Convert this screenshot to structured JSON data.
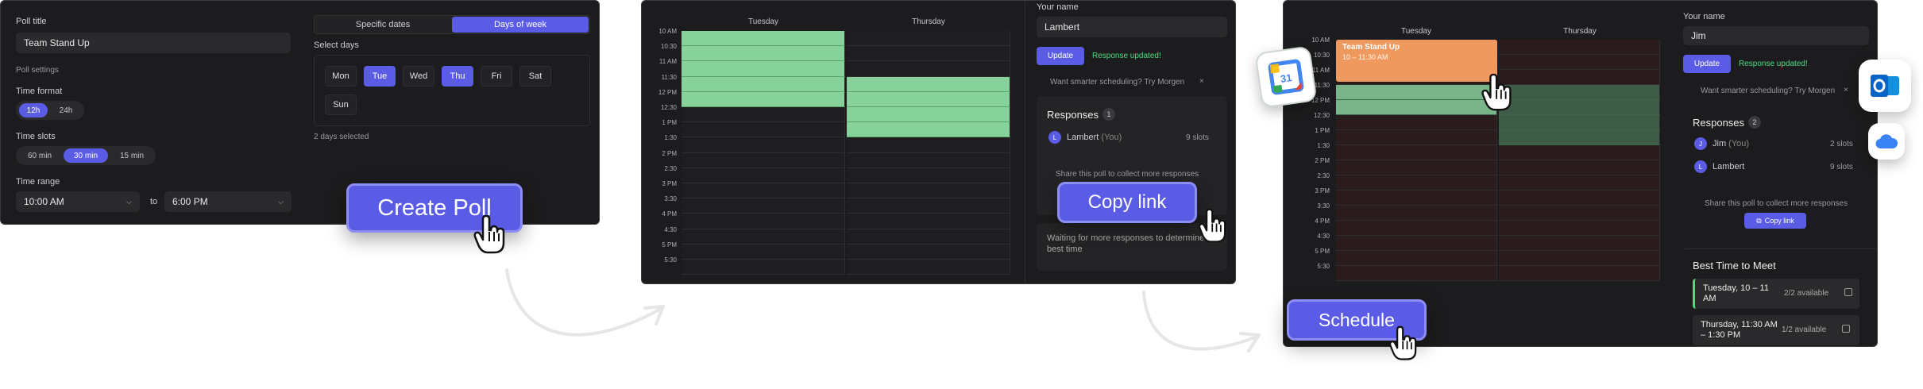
{
  "colors": {
    "accent": "#5b5ce6",
    "slot_green": "#86d29a",
    "event_orange": "#f0995f",
    "success_green": "#4ade80"
  },
  "panel1": {
    "poll_title_label": "Poll title",
    "poll_title_value": "Team Stand Up",
    "poll_settings_label": "Poll settings",
    "time_format_label": "Time format",
    "time_format_options": [
      "12h",
      "24h"
    ],
    "time_slots_label": "Time slots",
    "time_slot_options": [
      "60 min",
      "30 min",
      "15 min"
    ],
    "time_range_label": "Time range",
    "range_start": "10:00 AM",
    "range_to": "to",
    "range_end": "6:00 PM",
    "tab_specific": "Specific dates",
    "tab_days": "Days of week",
    "select_days_label": "Select days",
    "days": [
      "Mon",
      "Tue",
      "Wed",
      "Thu",
      "Fri",
      "Sat",
      "Sun"
    ],
    "days_selected": "2 days selected",
    "create_poll": "Create Poll"
  },
  "panel2": {
    "col_tuesday": "Tuesday",
    "col_thursday": "Thursday",
    "times": [
      "10 AM",
      "10:30",
      "11 AM",
      "11:30",
      "12 PM",
      "12:30",
      "1 PM",
      "1:30",
      "2 PM",
      "2:30",
      "3 PM",
      "3:30",
      "4 PM",
      "4:30",
      "5 PM",
      "5:30"
    ],
    "your_name_label": "Your name",
    "your_name_value": "Lambert",
    "update": "Update",
    "response_updated": "Response updated!",
    "promo": "Want smarter scheduling? Try Morgen",
    "close": "×",
    "responses_label": "Responses",
    "responses_count": "1",
    "resp_name": "Lambert",
    "resp_you": "(You)",
    "resp_slots": "9 slots",
    "share_text": "Share this poll to collect more responses",
    "copy_link": "Copy link",
    "waiting": "Waiting for more responses to determine the best time"
  },
  "panel3": {
    "col_tuesday": "Tuesday",
    "col_thursday": "Thursday",
    "times": [
      "10 AM",
      "10:30",
      "11 AM",
      "11:30",
      "12 PM",
      "12:30",
      "1 PM",
      "1:30",
      "2 PM",
      "2:30",
      "3 PM",
      "3:30",
      "4 PM",
      "4:30",
      "5 PM",
      "5:30"
    ],
    "event_title": "Team Stand Up",
    "event_time": "10 – 11:30 AM",
    "your_name_label": "Your name",
    "your_name_value": "Jim",
    "update": "Update",
    "response_updated": "Response updated!",
    "promo": "Want smarter scheduling? Try Morgen",
    "close": "×",
    "responses_label": "Responses",
    "responses_count": "2",
    "r1_initial": "J",
    "r1_name": "Jim",
    "r1_you": "(You)",
    "r1_slots": "2 slots",
    "r2_initial": "L",
    "r2_name": "Lambert",
    "r2_slots": "9 slots",
    "share_text": "Share this poll to collect more responses",
    "copy_link": "Copy link",
    "best_time_label": "Best Time to Meet",
    "best1_time": "Tuesday, 10 – 11 AM",
    "best1_avail": "2/2 available",
    "best2_time": "Thursday, 11:30 AM – 1:30 PM",
    "best2_avail": "1/2 available",
    "schedule": "Schedule"
  },
  "icons": [
    "google-calendar-icon",
    "outlook-icon",
    "icloud-icon",
    "hand-cursor-icon",
    "calendar-add-icon",
    "copy-icon"
  ]
}
